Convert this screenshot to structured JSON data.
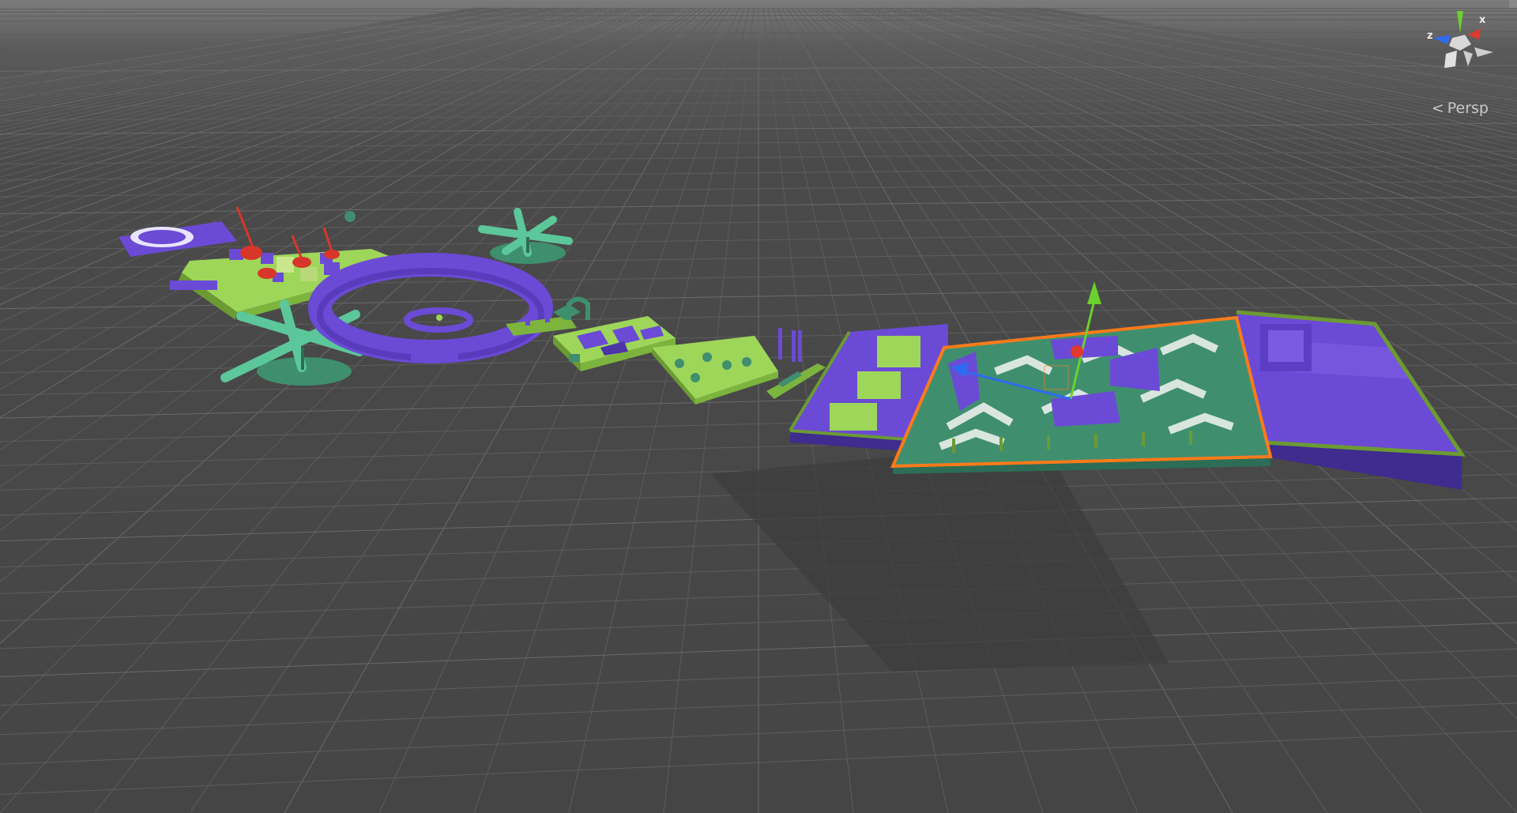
{
  "scene_view": {
    "projection_label": "Persp",
    "projection_icon": "chevron-left-icon",
    "gizmo": {
      "x_axis_label": "x",
      "z_axis_label": "z",
      "x_color": "#e03a2e",
      "y_color": "#6ad12d",
      "z_color": "#2f6bf0"
    },
    "selection_outline_color": "#ff7a1a",
    "grid_color": "#5d5d5d",
    "background_color": "#4a4a4a",
    "level_palette": {
      "purple": "#6b4ad6",
      "light_green": "#9ed65a",
      "teal": "#3f8f6f",
      "red": "#d8362b"
    }
  }
}
